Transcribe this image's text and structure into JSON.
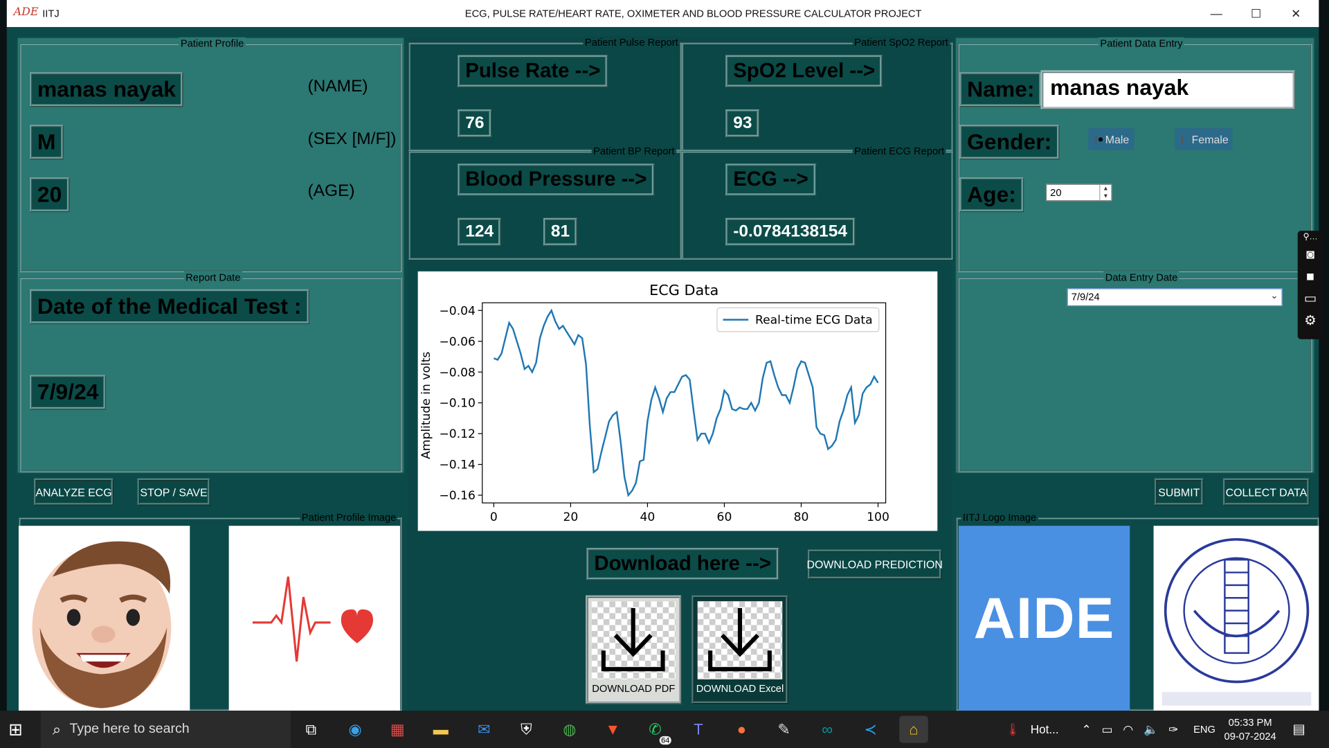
{
  "window": {
    "app_short": "IITJ",
    "title": "ECG, PULSE RATE/HEART RATE, OXIMETER AND BLOOD PRESSURE CALCULATOR PROJECT",
    "min": "—",
    "max": "☐",
    "close": "✕"
  },
  "profile": {
    "frame_label": "Patient Profile",
    "name_value": "manas nayak",
    "name_caption": "(NAME)",
    "sex_value": "M",
    "sex_caption": "(SEX [M/F])",
    "age_value": "20",
    "age_caption": "(AGE)"
  },
  "report_date": {
    "frame_label": "Report Date",
    "heading": "Date of the Medical Test :",
    "value": "7/9/24"
  },
  "left_buttons": {
    "analyze": "ANALYZE ECG",
    "stop": "STOP / SAVE"
  },
  "profile_image": {
    "frame_label": "Patient Profile Image"
  },
  "pulse": {
    "frame_label": "Patient Pulse Report",
    "heading": "Pulse Rate -->",
    "value": "76"
  },
  "spo2": {
    "frame_label": "Patient SpO2 Report",
    "heading": "SpO2 Level -->",
    "value": "93"
  },
  "bp": {
    "frame_label": "Patient  BP  Report",
    "heading": "Blood Pressure -->",
    "systolic": "124",
    "diastolic": "81"
  },
  "ecg": {
    "frame_label": "Patient  ECG  Report",
    "heading": "ECG -->",
    "value": "-0.0784138154"
  },
  "download": {
    "heading": "Download here -->",
    "prediction_button": "DOWNLOAD PREDICTION",
    "pdf_button": "DOWNLOAD PDF",
    "excel_button": "DOWNLOAD Excel"
  },
  "entry": {
    "frame_label": "Patient Data Entry",
    "name_label": "Name:",
    "name_value": "manas nayak",
    "gender_label": "Gender:",
    "gender_options": [
      "Male",
      "Female"
    ],
    "gender_selected": "Male",
    "age_label": "Age:",
    "age_value": "20"
  },
  "entry_date": {
    "frame_label": "Data Entry Date",
    "value": "7/9/24"
  },
  "right_buttons": {
    "submit": "SUBMIT",
    "collect": "COLLECT DATA"
  },
  "logo": {
    "frame_label": "IITJ Logo Image",
    "aide_text": "AIDE"
  },
  "taskbar": {
    "search_placeholder": "Type here to search",
    "weather": "Hot...",
    "language": "ENG",
    "time": "05:33 PM",
    "date": "09-07-2024",
    "whatsapp_badge": "64"
  },
  "colors": {
    "window_bg": "#0b4a48",
    "panel_bg": "#2c7873",
    "line": "#1f77b4"
  },
  "chart_data": {
    "type": "line",
    "title": "ECG Data",
    "xlabel": "",
    "ylabel": "Amplitude in volts",
    "xlim": [
      -3,
      102
    ],
    "ylim": [
      -0.165,
      -0.035
    ],
    "xticks": [
      0,
      20,
      40,
      60,
      80,
      100
    ],
    "yticks": [
      -0.04,
      -0.06,
      -0.08,
      -0.1,
      -0.12,
      -0.14,
      -0.16
    ],
    "ytick_labels": [
      "−0.04",
      "−0.06",
      "−0.08",
      "−0.10",
      "−0.12",
      "−0.14",
      "−0.16"
    ],
    "legend_position": "top-right",
    "grid": false,
    "series": [
      {
        "name": "Real-time ECG Data",
        "x": [
          0,
          1,
          2,
          3,
          4,
          5,
          6,
          7,
          8,
          9,
          10,
          11,
          12,
          13,
          14,
          15,
          16,
          17,
          18,
          19,
          20,
          21,
          22,
          23,
          24,
          25,
          26,
          27,
          28,
          29,
          30,
          31,
          32,
          33,
          34,
          35,
          36,
          37,
          38,
          39,
          40,
          41,
          42,
          43,
          44,
          45,
          46,
          47,
          48,
          49,
          50,
          51,
          52,
          53,
          54,
          55,
          56,
          57,
          58,
          59,
          60,
          61,
          62,
          63,
          64,
          65,
          66,
          67,
          68,
          69,
          70,
          71,
          72,
          73,
          74,
          75,
          76,
          77,
          78,
          79,
          80,
          81,
          82,
          83,
          84,
          85,
          86,
          87,
          88,
          89,
          90,
          91,
          92,
          93,
          94,
          95,
          96,
          97,
          98,
          99,
          100
        ],
        "y": [
          -0.071,
          -0.072,
          -0.068,
          -0.058,
          -0.048,
          -0.052,
          -0.06,
          -0.068,
          -0.078,
          -0.076,
          -0.08,
          -0.074,
          -0.058,
          -0.05,
          -0.044,
          -0.04,
          -0.047,
          -0.052,
          -0.05,
          -0.054,
          -0.058,
          -0.062,
          -0.056,
          -0.058,
          -0.075,
          -0.115,
          -0.145,
          -0.143,
          -0.132,
          -0.122,
          -0.112,
          -0.108,
          -0.106,
          -0.125,
          -0.148,
          -0.16,
          -0.157,
          -0.152,
          -0.138,
          -0.137,
          -0.112,
          -0.098,
          -0.09,
          -0.097,
          -0.106,
          -0.097,
          -0.093,
          -0.093,
          -0.088,
          -0.083,
          -0.082,
          -0.085,
          -0.105,
          -0.124,
          -0.12,
          -0.12,
          -0.126,
          -0.12,
          -0.11,
          -0.104,
          -0.092,
          -0.095,
          -0.104,
          -0.105,
          -0.103,
          -0.104,
          -0.104,
          -0.1,
          -0.105,
          -0.1,
          -0.084,
          -0.074,
          -0.073,
          -0.082,
          -0.09,
          -0.095,
          -0.095,
          -0.1,
          -0.09,
          -0.078,
          -0.073,
          -0.074,
          -0.082,
          -0.09,
          -0.116,
          -0.12,
          -0.121,
          -0.13,
          -0.128,
          -0.124,
          -0.112,
          -0.105,
          -0.095,
          -0.09,
          -0.113,
          -0.108,
          -0.094,
          -0.09,
          -0.088,
          -0.083,
          -0.087
        ]
      }
    ]
  }
}
